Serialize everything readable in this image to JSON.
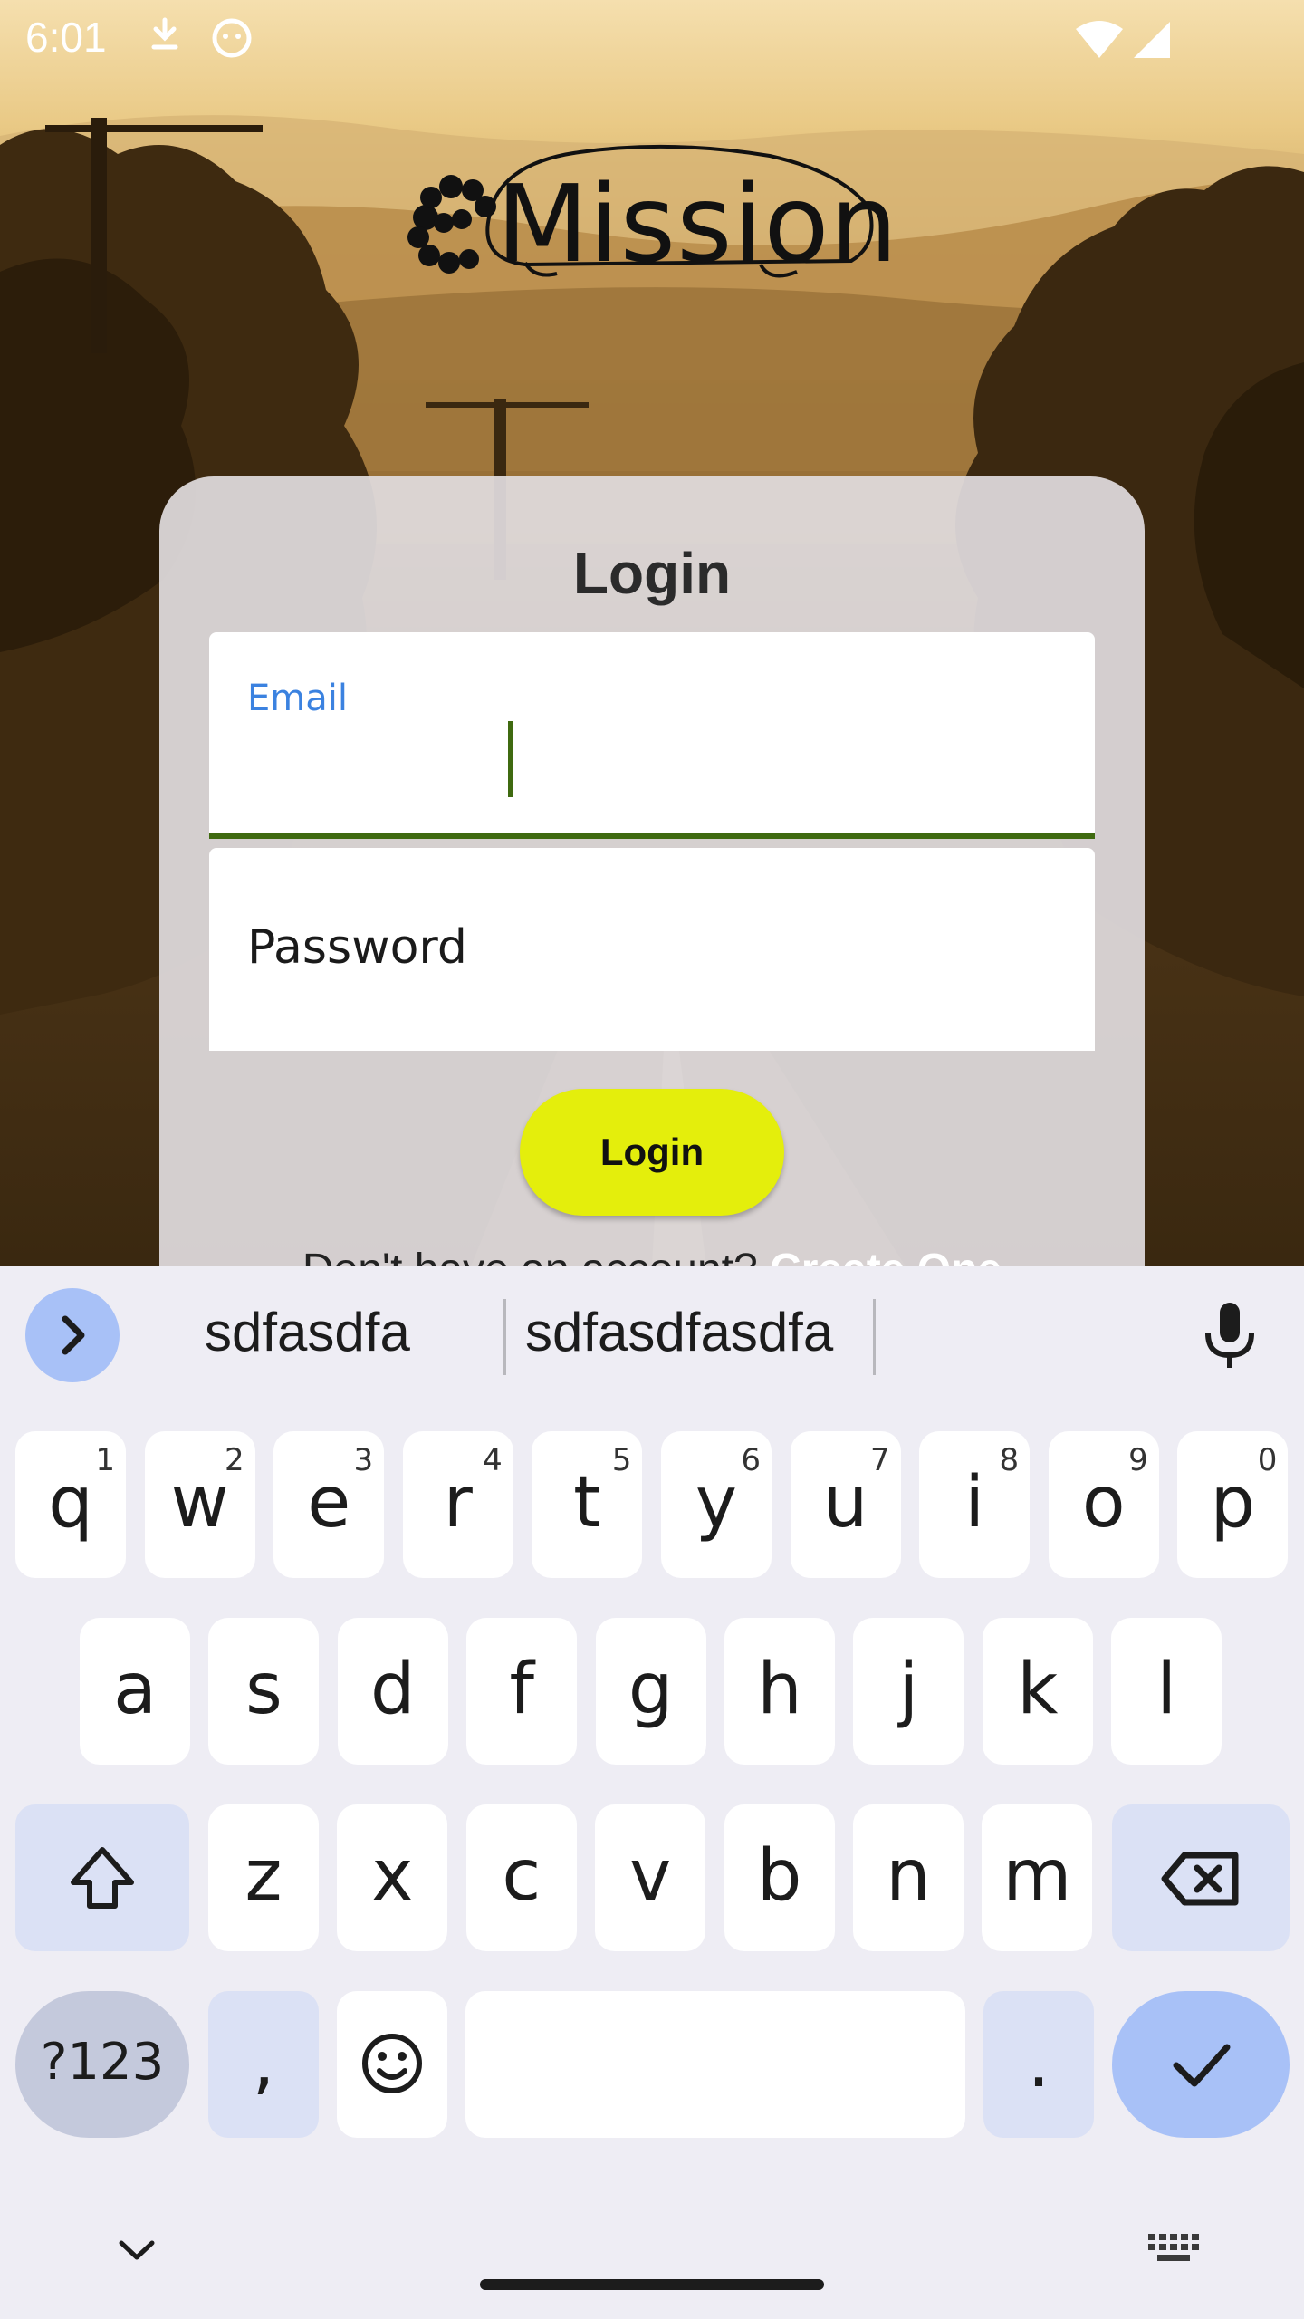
{
  "status_bar": {
    "time": "6:01"
  },
  "app": {
    "logo_text": "Mission"
  },
  "login_card": {
    "title": "Login",
    "email_label": "Email",
    "password_placeholder": "Password",
    "login_button": "Login",
    "signup_prompt": "Don't have an account?",
    "signup_link": "Create One"
  },
  "keyboard": {
    "suggestions": [
      "sdfasdfa",
      "sdfasdfasdfa"
    ],
    "row1": [
      {
        "k": "q",
        "h": "1"
      },
      {
        "k": "w",
        "h": "2"
      },
      {
        "k": "e",
        "h": "3"
      },
      {
        "k": "r",
        "h": "4"
      },
      {
        "k": "t",
        "h": "5"
      },
      {
        "k": "y",
        "h": "6"
      },
      {
        "k": "u",
        "h": "7"
      },
      {
        "k": "i",
        "h": "8"
      },
      {
        "k": "o",
        "h": "9"
      },
      {
        "k": "p",
        "h": "0"
      }
    ],
    "row2": [
      "a",
      "s",
      "d",
      "f",
      "g",
      "h",
      "j",
      "k",
      "l"
    ],
    "row3": [
      "z",
      "x",
      "c",
      "v",
      "b",
      "n",
      "m"
    ],
    "symbols_key": "?123",
    "comma_key": ",",
    "period_key": "."
  },
  "colors": {
    "accent_field": "#3f6a10",
    "label_blue": "#3b82e0",
    "login_button": "#e4ee0c",
    "keyboard_bg": "#eeedf4",
    "enter_key": "#a8c1f7"
  },
  "icons": [
    "wifi-icon",
    "signal-icon",
    "chevron-right-icon",
    "mic-icon",
    "shift-icon",
    "backspace-icon",
    "emoji-icon",
    "check-icon",
    "chevron-down-icon",
    "keyboard-icon"
  ]
}
